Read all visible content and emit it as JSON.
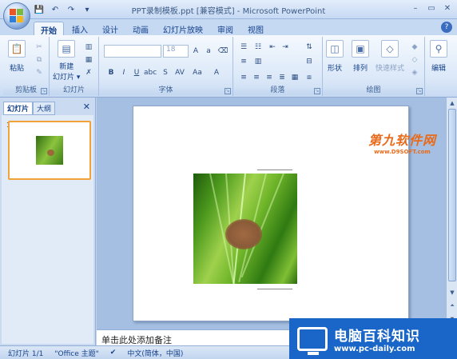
{
  "window": {
    "title": "PPT录制模板.ppt [兼容模式] - Microsoft PowerPoint",
    "minimize": "–",
    "restore": "▭",
    "close": "✕"
  },
  "qat": {
    "save": "💾",
    "undo": "↶",
    "redo": "↷",
    "more": "▾"
  },
  "tabs": [
    "开始",
    "插入",
    "设计",
    "动画",
    "幻灯片放映",
    "审阅",
    "视图"
  ],
  "active_tab": "开始",
  "help": "?",
  "ribbon": {
    "clipboard": {
      "label": "剪贴板",
      "paste": "粘贴"
    },
    "slides": {
      "label": "幻灯片",
      "new_slide": "新建",
      "new_slide2": "幻灯片 ▾"
    },
    "font": {
      "label": "字体",
      "font_name": "",
      "font_size": "18"
    },
    "paragraph": {
      "label": "段落"
    },
    "drawing": {
      "label": "绘图",
      "shapes": "形状",
      "arrange": "排列",
      "quick_styles": "快速样式"
    },
    "editing": {
      "label": "编辑"
    }
  },
  "left_panel": {
    "tab_slides": "幻灯片",
    "tab_outline": "大纲",
    "close": "✕",
    "slide_number": "1"
  },
  "watermark": {
    "title": "第九软件网",
    "url": "www.D9SOFT.com"
  },
  "notes": {
    "placeholder": "单击此处添加备注"
  },
  "status": {
    "slide": "幻灯片 1/1",
    "theme": "\"Office 主题\"",
    "language": "中文(简体，中国)"
  },
  "badge": {
    "title": "电脑百科知识",
    "url": "www.pc-daily.com"
  },
  "colors": {
    "ribbon_bg": "#dbe8f8",
    "accent": "#15428b",
    "badge_bg": "#1a66c8",
    "watermark": "#e86a1a"
  }
}
